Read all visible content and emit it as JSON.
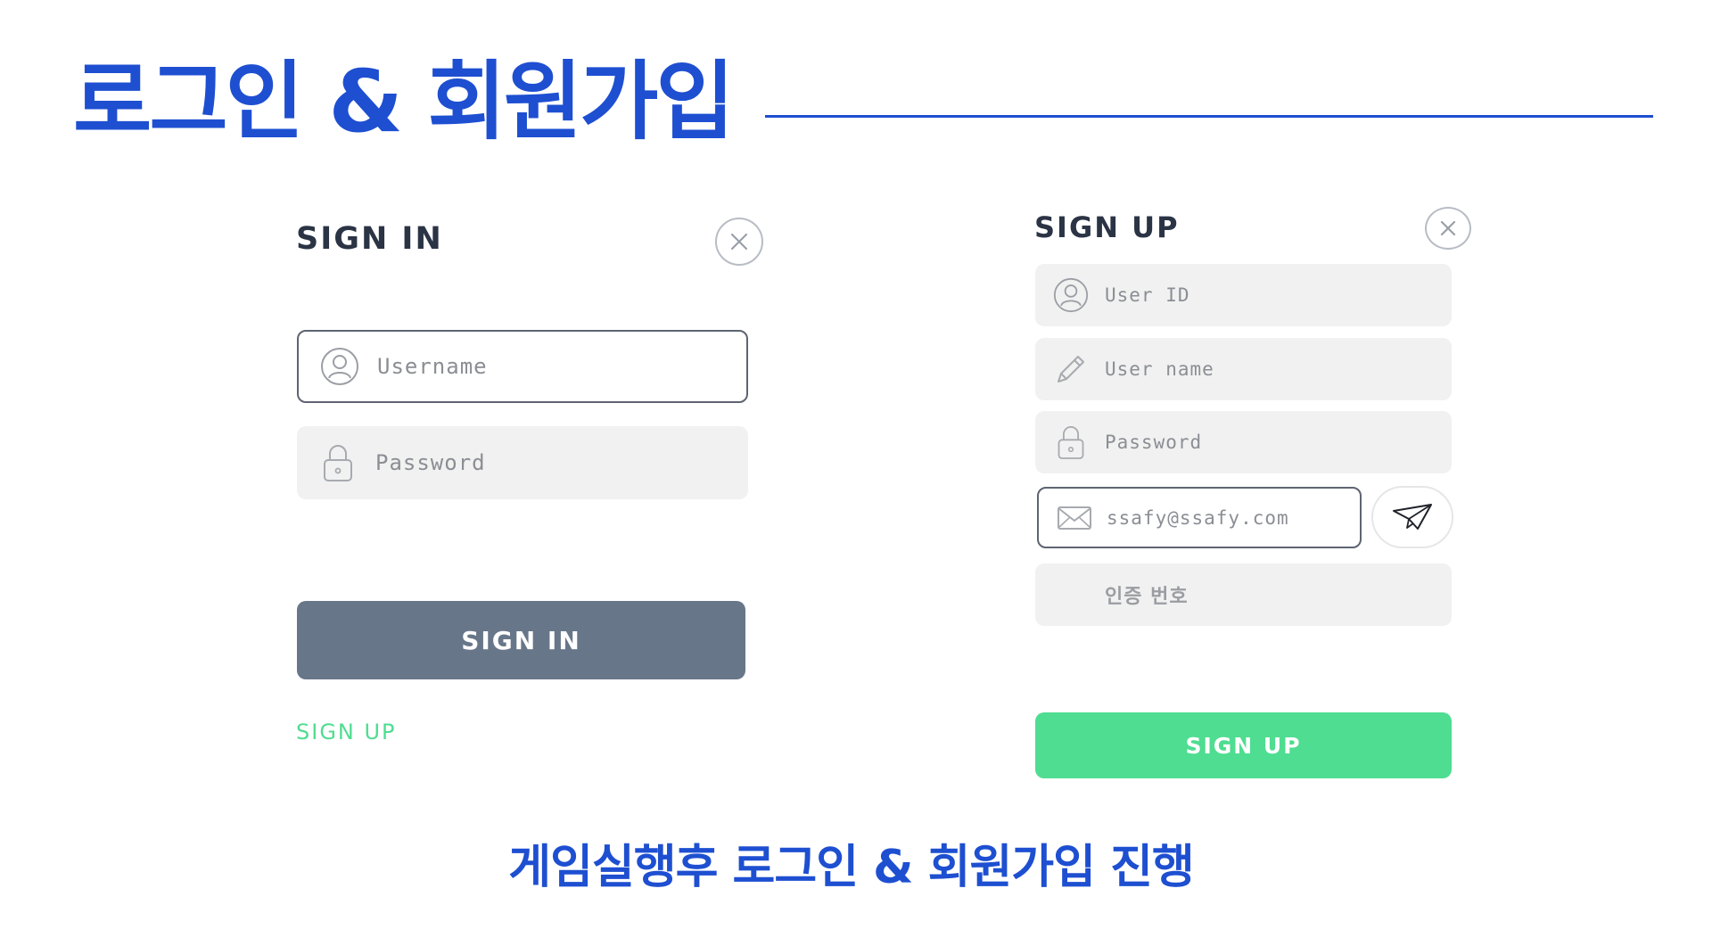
{
  "header": {
    "title": "로그인 & 회원가입"
  },
  "signin": {
    "title": "SIGN IN",
    "username_placeholder": "Username",
    "password_placeholder": "Password",
    "submit_label": "SIGN IN",
    "signup_link": "SIGN UP"
  },
  "signup": {
    "title": "SIGN UP",
    "userid_placeholder": "User ID",
    "username_placeholder": "User name",
    "password_placeholder": "Password",
    "email_value": "ssafy@ssafy.com",
    "auth_code_placeholder": "인증 번호",
    "submit_label": "SIGN UP"
  },
  "caption": "게임실행후 로그인 & 회원가입 진행",
  "icons": [
    "close-icon",
    "user-icon",
    "lock-icon",
    "pencil-icon",
    "mail-icon",
    "paper-plane-icon"
  ],
  "colors": {
    "accent_blue": "#1e4fd1",
    "signin_button": "#687689",
    "signup_green": "#4fdd91",
    "field_bg": "#f1f1f1"
  }
}
